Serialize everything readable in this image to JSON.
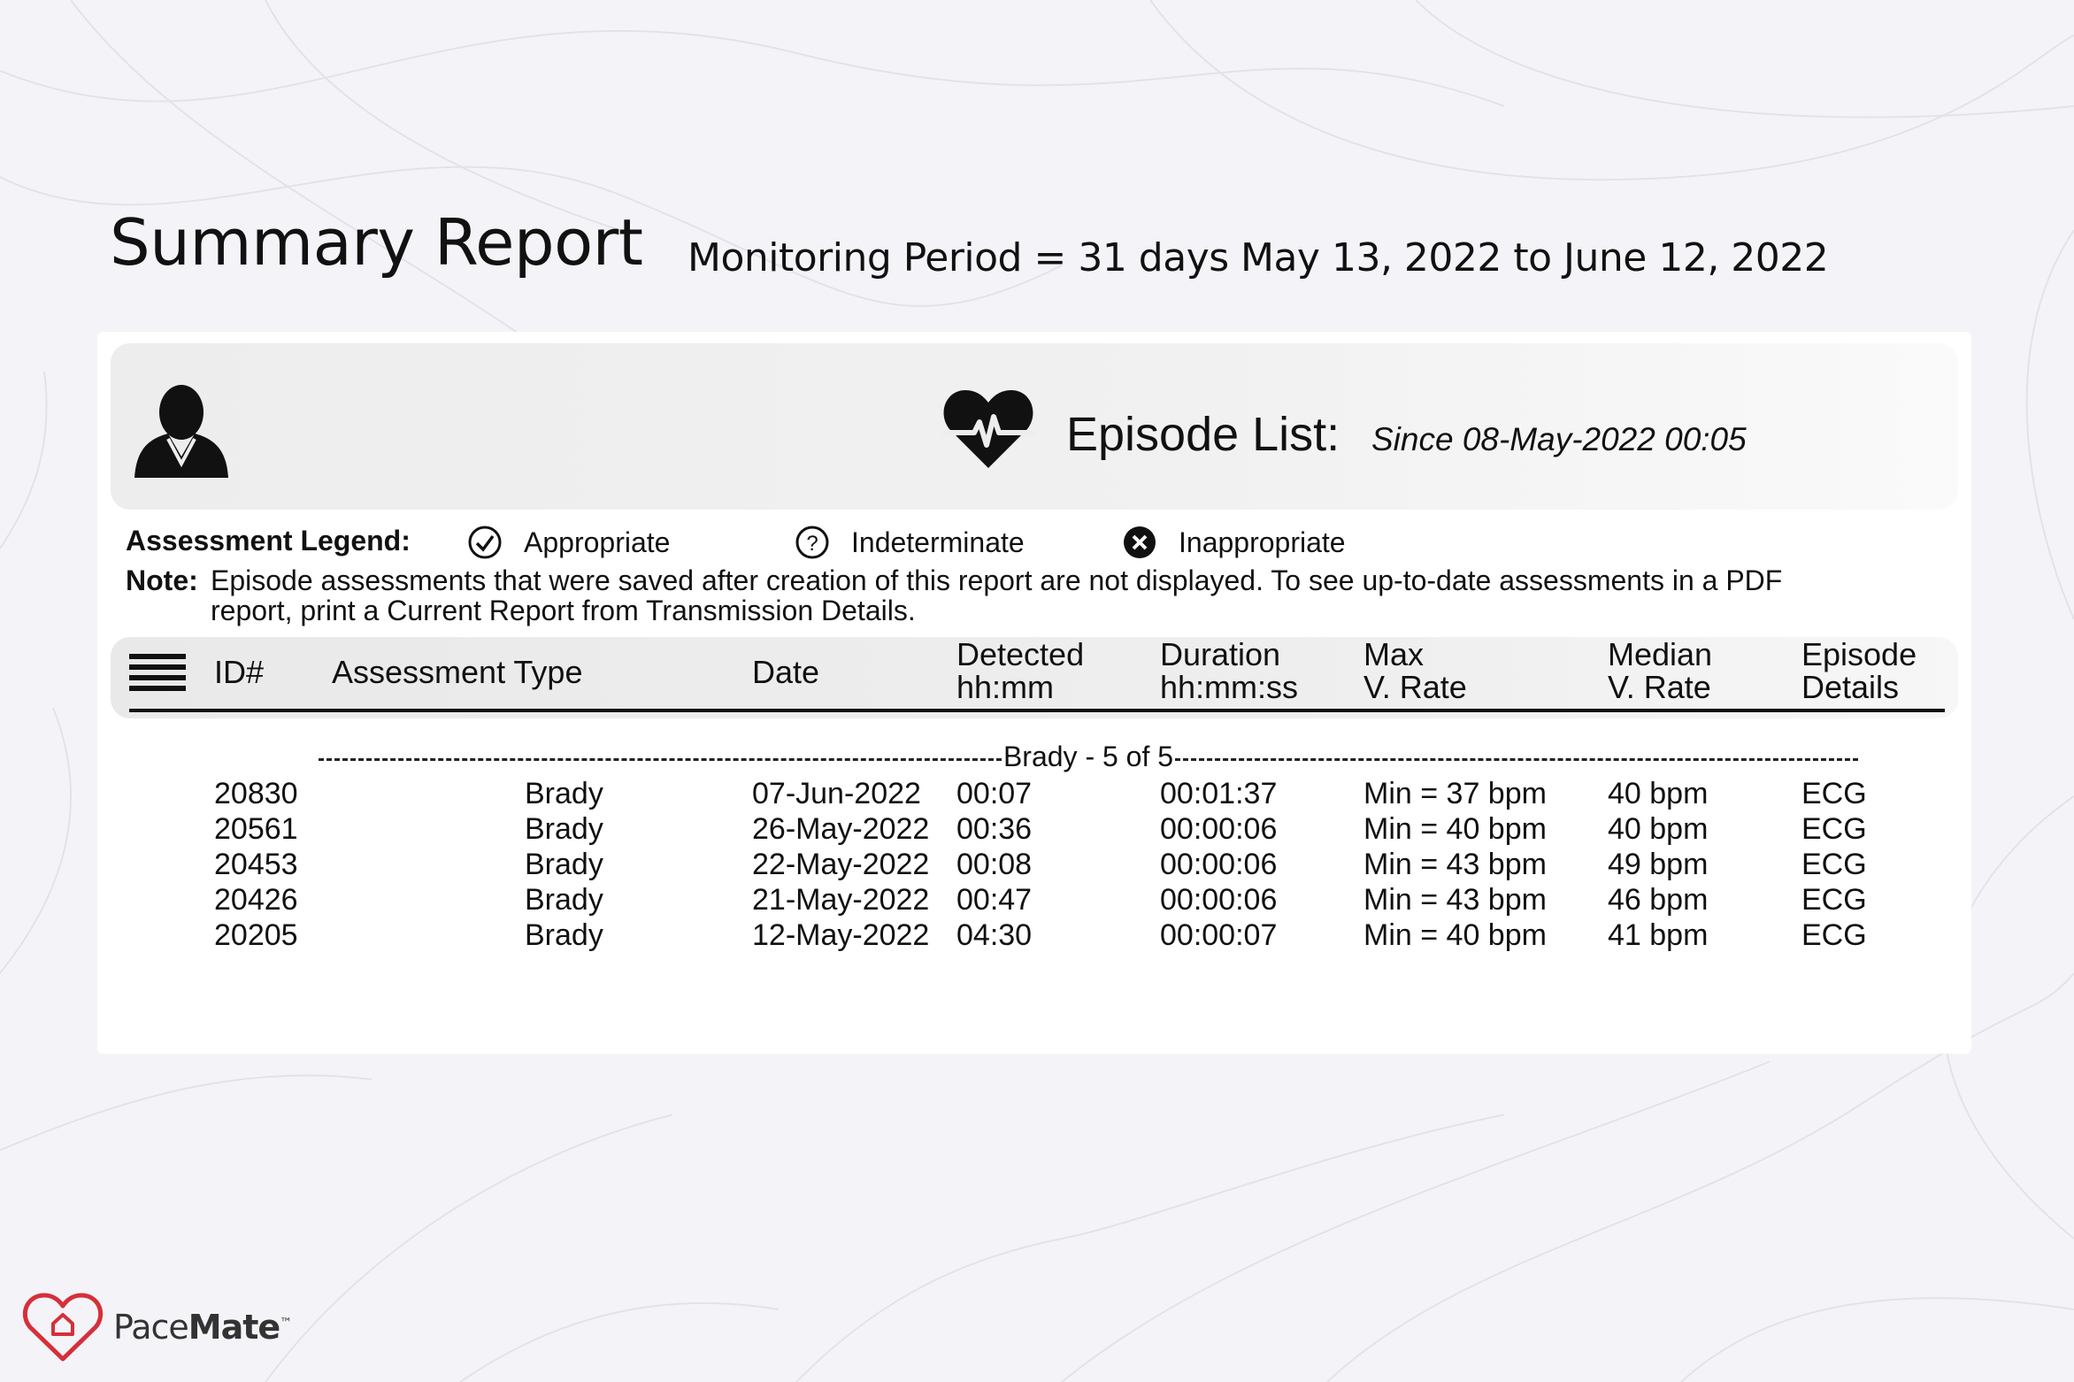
{
  "header": {
    "title": "Summary Report",
    "period": "Monitoring Period = 31 days",
    "dates": "May 13, 2022 to June 12, 2022"
  },
  "banner": {
    "title": "Episode List:",
    "since": "Since 08-May-2022 00:05"
  },
  "legend": {
    "label": "Assessment Legend:",
    "items": [
      {
        "icon": "check-circle-icon",
        "label": "Appropriate"
      },
      {
        "icon": "question-circle-icon",
        "label": "Indeterminate"
      },
      {
        "icon": "x-circle-icon",
        "label": "Inappropriate"
      }
    ]
  },
  "note": {
    "label": "Note:",
    "line1": "Episode assessments that were saved after creation of this report are not displayed. To see up-to-date assessments in a PDF",
    "line2": "report, print a Current Report from Transmission Details."
  },
  "table": {
    "columns": [
      {
        "line1": "ID#",
        "line2": ""
      },
      {
        "line1": "Assessment Type",
        "line2": ""
      },
      {
        "line1": "Date",
        "line2": ""
      },
      {
        "line1": "Detected",
        "line2": "hh:mm"
      },
      {
        "line1": "Duration",
        "line2": "hh:mm:ss"
      },
      {
        "line1": "Max",
        "line2": "V. Rate"
      },
      {
        "line1": "Median",
        "line2": "V. Rate"
      },
      {
        "line1": "Episode",
        "line2": "Details"
      }
    ],
    "group_label": "Brady - 5 of 5",
    "rows": [
      [
        "20830",
        "Brady",
        "07-Jun-2022",
        "00:07",
        "00:01:37",
        "Min = 37 bpm",
        "40 bpm",
        "ECG"
      ],
      [
        "20561",
        "Brady",
        "26-May-2022",
        "00:36",
        "00:00:06",
        "Min = 40 bpm",
        "40 bpm",
        "ECG"
      ],
      [
        "20453",
        "Brady",
        "22-May-2022",
        "00:08",
        "00:00:06",
        "Min = 43 bpm",
        "49 bpm",
        "ECG"
      ],
      [
        "20426",
        "Brady",
        "21-May-2022",
        "00:47",
        "00:00:06",
        "Min = 43 bpm",
        "46 bpm",
        "ECG"
      ],
      [
        "20205",
        "Brady",
        "12-May-2022",
        "04:30",
        "00:00:07",
        "Min = 40 bpm",
        "41 bpm",
        "ECG"
      ]
    ]
  },
  "brand": {
    "name_light": "Pace",
    "name_bold": "Mate",
    "tm": "™",
    "color": "#d62f3a"
  }
}
